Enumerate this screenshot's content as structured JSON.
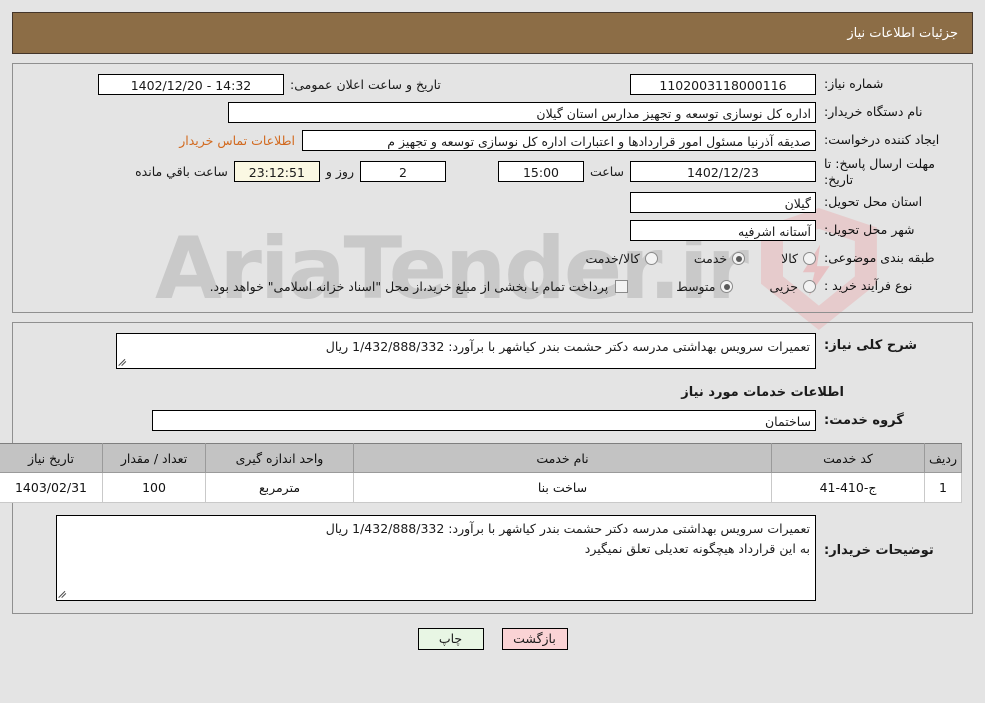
{
  "header": {
    "title": "جزئیات اطلاعات نیاز"
  },
  "colors": {
    "header_bg": "#8c6d46",
    "header_text": "#ffffff",
    "page_bg": "#e4e4e4",
    "link": "#d2691e",
    "table_header_bg": "#c3c3c3",
    "countdown_bg": "#fbf8e3",
    "print_button_bg": "#e8f6e4",
    "back_button_bg": "#fad3d5"
  },
  "info": {
    "need_number_label": "شماره نیاز:",
    "need_number_value": "1102003118000116",
    "announce_label": "تاریخ و ساعت اعلان عمومی:",
    "announce_value": "14:32 - 1402/12/20",
    "buyer_org_label": "نام دستگاه خریدار:",
    "buyer_org_value": "اداره کل نوسازی  توسعه و تجهیز مدارس استان گیلان",
    "creator_label": "ایجاد کننده درخواست:",
    "creator_value": "صدیقه آذرنیا مسئول امور قراردادها و اعتبارات اداره کل نوسازی  توسعه و تجهیز م",
    "contact_link": "اطلاعات تماس خریدار",
    "deadline_label": "مهلت ارسال پاسخ: تا تاریخ:",
    "deadline_date": "1402/12/23",
    "deadline_hour_label": "ساعت",
    "deadline_hour_value": "15:00",
    "days_value": "2",
    "days_label": "روز و",
    "countdown_value": "23:12:51",
    "countdown_label": "ساعت باقي مانده",
    "province_label": "استان محل تحویل:",
    "province_value": "گیلان",
    "city_label": "شهر محل تحویل:",
    "city_value": "آستانه اشرفیه",
    "category_label": "طبقه بندی موضوعی:",
    "category_options": [
      {
        "label": "کالا",
        "selected": false
      },
      {
        "label": "خدمت",
        "selected": true
      },
      {
        "label": "کالا/خدمت",
        "selected": false
      }
    ],
    "process_label": "نوع فرآیند خرید :",
    "process_options": [
      {
        "label": "جزیی",
        "selected": false
      },
      {
        "label": "متوسط",
        "selected": true
      }
    ],
    "treasury_checkbox_label": "پرداخت تمام یا بخشی از مبلغ خرید،از محل \"اسناد خزانه اسلامی\" خواهد بود.",
    "treasury_checked": false
  },
  "description": {
    "label": "شرح کلی نیاز:",
    "value": "تعمیرات سرویس بهداشتی مدرسه دکتر حشمت بندر کیاشهر با برآورد: 1/432/888/332 ریال"
  },
  "services": {
    "heading": "اطلاعات خدمات مورد نیاز",
    "group_label": "گروه خدمت:",
    "group_value": "ساختمان",
    "columns": [
      "ردیف",
      "کد خدمت",
      "نام خدمت",
      "واحد اندازه گیری",
      "تعداد / مقدار",
      "تاریخ نیاز"
    ],
    "rows": [
      {
        "radif": "1",
        "code": "ج-410-41",
        "name": "ساخت بنا",
        "unit": "مترمربع",
        "qty": "100",
        "date": "1403/02/31"
      }
    ]
  },
  "buyer_notes": {
    "label": "توضیحات خریدار:",
    "line1": "تعمیرات سرویس بهداشتی مدرسه دکتر حشمت بندر کیاشهر با برآورد: 1/432/888/332 ریال",
    "line2": "به این قرارداد هیچگونه تعدیلی تعلق نمیگیرد"
  },
  "buttons": {
    "print": "چاپ",
    "back": "بازگشت"
  },
  "watermark": {
    "text": "AriaTender.ir"
  }
}
